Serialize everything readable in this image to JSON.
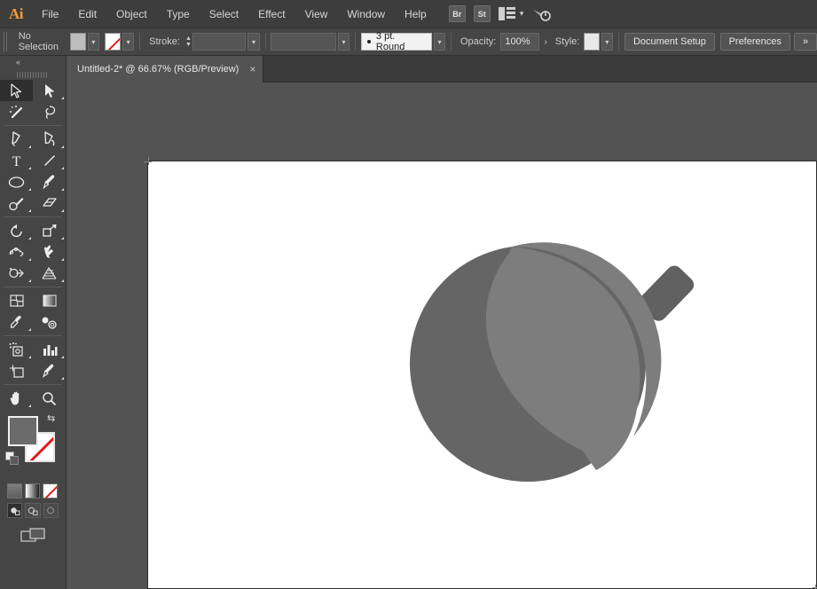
{
  "app": {
    "name": "Adobe Illustrator",
    "logo_text": "Ai",
    "accent_color": "#f59b3d"
  },
  "menubar": {
    "items": [
      {
        "label": "File"
      },
      {
        "label": "Edit"
      },
      {
        "label": "Object"
      },
      {
        "label": "Type"
      },
      {
        "label": "Select"
      },
      {
        "label": "Effect"
      },
      {
        "label": "View"
      },
      {
        "label": "Window"
      },
      {
        "label": "Help"
      }
    ],
    "bridge_label": "Br",
    "stock_label": "St",
    "workspace_icon": "workspace-layout-icon",
    "workspace_chevron": "▾",
    "help_icon": "search-help-icon"
  },
  "controlbar": {
    "selection_status": "No Selection",
    "fill_swatch_color": "#bdbdbd",
    "stroke_swatch_value": "None",
    "stroke_label": "Stroke:",
    "stroke_weight_value": "",
    "brush_definition": "3 pt. Round",
    "opacity_label": "Opacity:",
    "opacity_value": "100%",
    "style_label": "Style:",
    "style_swatch_color": "#e9e9e9",
    "document_setup_label": "Document Setup",
    "preferences_label": "Preferences",
    "overflow_label": "»",
    "fill_chevron": "▾",
    "stroke_chevron": "▾",
    "weight_chevron": "▾",
    "brush_chevron": "▾",
    "opacity_arrow": "›",
    "style_chevron": "▾"
  },
  "tabbar": {
    "documents": [
      {
        "title": "Untitled-2* @ 66.67% (RGB/Preview)",
        "close_glyph": "×",
        "active": true
      }
    ]
  },
  "toolpanel": {
    "collapse_glyph": "«",
    "tools": [
      {
        "name": "selection-tool",
        "label": "Selection",
        "active": true,
        "has_flyout": false
      },
      {
        "name": "direct-selection-tool",
        "label": "Direct Selection",
        "active": false,
        "has_flyout": true
      },
      {
        "name": "magic-wand-tool",
        "label": "Magic Wand",
        "active": false,
        "has_flyout": false
      },
      {
        "name": "lasso-tool",
        "label": "Lasso",
        "active": false,
        "has_flyout": false
      },
      {
        "name": "pen-tool",
        "label": "Pen",
        "active": false,
        "has_flyout": true
      },
      {
        "name": "curvature-tool",
        "label": "Curvature",
        "active": false,
        "has_flyout": false
      },
      {
        "name": "type-tool",
        "label": "Type",
        "active": false,
        "has_flyout": true
      },
      {
        "name": "line-segment-tool",
        "label": "Line Segment",
        "active": false,
        "has_flyout": true
      },
      {
        "name": "ellipse-tool",
        "label": "Ellipse",
        "active": false,
        "has_flyout": true
      },
      {
        "name": "paintbrush-tool",
        "label": "Paintbrush",
        "active": false,
        "has_flyout": true
      },
      {
        "name": "shaper-tool",
        "label": "Shaper",
        "active": false,
        "has_flyout": true
      },
      {
        "name": "eraser-tool",
        "label": "Eraser",
        "active": false,
        "has_flyout": true
      },
      {
        "name": "rotate-tool",
        "label": "Rotate",
        "active": false,
        "has_flyout": true
      },
      {
        "name": "scale-tool",
        "label": "Scale",
        "active": false,
        "has_flyout": true
      },
      {
        "name": "width-tool",
        "label": "Width",
        "active": false,
        "has_flyout": true
      },
      {
        "name": "free-transform-tool",
        "label": "Free Transform",
        "active": false,
        "has_flyout": true
      },
      {
        "name": "shape-builder-tool",
        "label": "Shape Builder",
        "active": false,
        "has_flyout": true
      },
      {
        "name": "perspective-grid-tool",
        "label": "Perspective Grid",
        "active": false,
        "has_flyout": true
      },
      {
        "name": "mesh-tool",
        "label": "Mesh",
        "active": false,
        "has_flyout": false
      },
      {
        "name": "gradient-tool",
        "label": "Gradient",
        "active": false,
        "has_flyout": false
      },
      {
        "name": "eyedropper-tool",
        "label": "Eyedropper",
        "active": false,
        "has_flyout": true
      },
      {
        "name": "blend-tool",
        "label": "Blend",
        "active": false,
        "has_flyout": false
      },
      {
        "name": "symbol-sprayer-tool",
        "label": "Symbol Sprayer",
        "active": false,
        "has_flyout": true
      },
      {
        "name": "column-graph-tool",
        "label": "Column Graph",
        "active": false,
        "has_flyout": true
      },
      {
        "name": "artboard-tool",
        "label": "Artboard",
        "active": false,
        "has_flyout": false
      },
      {
        "name": "slice-tool",
        "label": "Slice",
        "active": false,
        "has_flyout": true
      },
      {
        "name": "hand-tool",
        "label": "Hand",
        "active": false,
        "has_flyout": true
      },
      {
        "name": "zoom-tool",
        "label": "Zoom",
        "active": false,
        "has_flyout": false
      }
    ],
    "fill_color": "#6b6b6b",
    "stroke_color": "None",
    "swap_glyph": "⇆",
    "mode_buttons": [
      {
        "name": "color-mode-button",
        "label": "Color",
        "active": true
      },
      {
        "name": "gradient-mode-button",
        "label": "Gradient",
        "active": false
      },
      {
        "name": "none-mode-button",
        "label": "None",
        "active": false
      }
    ],
    "draw_modes": [
      {
        "name": "draw-normal-button",
        "label": "Draw Normal",
        "active": true
      },
      {
        "name": "draw-behind-button",
        "label": "Draw Behind",
        "active": false
      },
      {
        "name": "draw-inside-button",
        "label": "Draw Inside",
        "active": false
      }
    ],
    "screen_mode_label": "Change Screen Mode"
  },
  "canvas": {
    "background_color": "#535353",
    "artboard_color": "#ffffff",
    "zoom_level": "66.67%",
    "artwork": {
      "name": "bomb-illustration",
      "body_color": "#656565",
      "highlight_color": "#7d7d7d",
      "cap_color": "#616161",
      "description": "Gray bomb: dark circle body with lighter crescent highlight and angled fuse cap"
    }
  }
}
